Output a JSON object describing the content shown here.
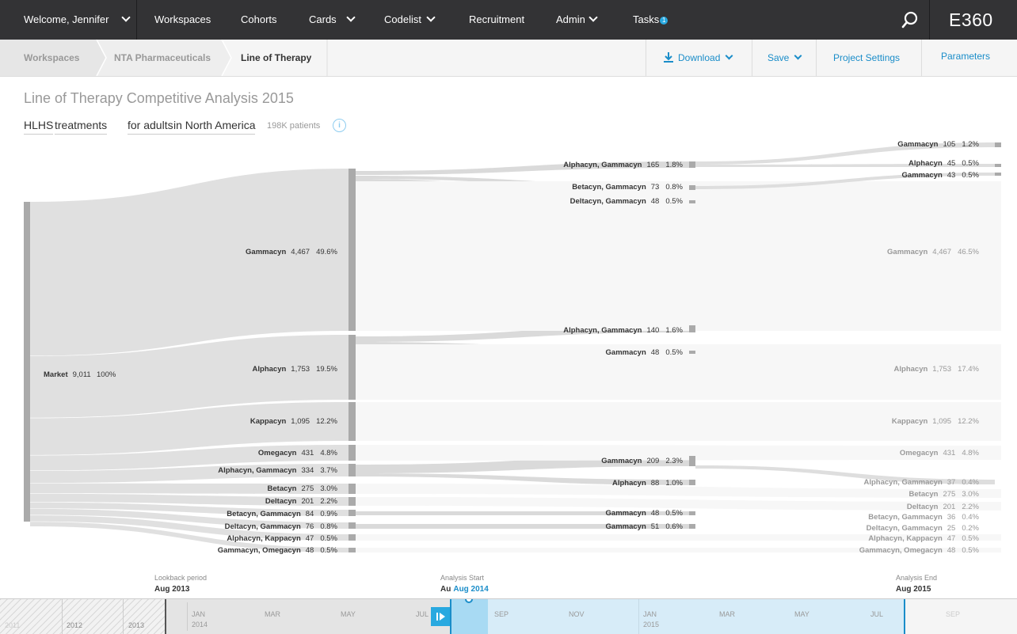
{
  "nav": {
    "welcome": "Welcome, Jennifer",
    "items": [
      "Workspaces",
      "Cohorts",
      "Cards",
      "Codelist",
      "Recruitment",
      "Admin",
      "Tasks"
    ],
    "tasks_badge": "1",
    "brand": "E360",
    "search_icon": "search-icon"
  },
  "breadcrumb": {
    "items": [
      "Workspaces",
      "NTA Pharmaceuticals",
      "Line of Therapy"
    ]
  },
  "actions": {
    "download": "Download",
    "save": "Save",
    "project_settings": "Project Settings",
    "parameters": "Parameters",
    "download_icon": "download-icon"
  },
  "page": {
    "title": "Line of Therapy Competitive Analysis 2015",
    "filters": [
      "HLHS",
      "treatments",
      "for adults",
      "in North America"
    ],
    "patients": "198K patients",
    "info_icon": "info-icon"
  },
  "colors": {
    "accent": "#1a8dc9",
    "topbar": "#333335",
    "node": "#aaaaaa",
    "link": "#dddddd"
  },
  "sankey": {
    "root": {
      "name": "Market",
      "count": "9,011",
      "pct": "100%"
    },
    "level1": [
      {
        "name": "Gammacyn",
        "count": "4,467",
        "pct": "49.6%"
      },
      {
        "name": "Alphacyn",
        "count": "1,753",
        "pct": "19.5%"
      },
      {
        "name": "Kappacyn",
        "count": "1,095",
        "pct": "12.2%"
      },
      {
        "name": "Omegacyn",
        "count": "431",
        "pct": "4.8%"
      },
      {
        "name": "Alphacyn, Gammacyn",
        "count": "334",
        "pct": "3.7%"
      },
      {
        "name": "Betacyn",
        "count": "275",
        "pct": "3.0%"
      },
      {
        "name": "Deltacyn",
        "count": "201",
        "pct": "2.2%"
      },
      {
        "name": "Betacyn, Gammacyn",
        "count": "84",
        "pct": "0.9%"
      },
      {
        "name": "Deltacyn, Gammacyn",
        "count": "76",
        "pct": "0.8%"
      },
      {
        "name": "Alphacyn, Kappacyn",
        "count": "47",
        "pct": "0.5%"
      },
      {
        "name": "Gammacyn, Omegacyn",
        "count": "48",
        "pct": "0.5%"
      }
    ],
    "level2": [
      {
        "name": "Alphacyn, Gammacyn",
        "count": "165",
        "pct": "1.8%"
      },
      {
        "name": "Betacyn, Gammacyn",
        "count": "73",
        "pct": "0.8%"
      },
      {
        "name": "Deltacyn, Gammacyn",
        "count": "48",
        "pct": "0.5%"
      },
      {
        "name": "Alphacyn, Gammacyn",
        "count": "140",
        "pct": "1.6%"
      },
      {
        "name": "Gammacyn",
        "count": "48",
        "pct": "0.5%"
      },
      {
        "name": "Gammacyn",
        "count": "209",
        "pct": "2.3%"
      },
      {
        "name": "Alphacyn",
        "count": "88",
        "pct": "1.0%"
      },
      {
        "name": "Gammacyn",
        "count": "48",
        "pct": "0.5%"
      },
      {
        "name": "Gammacyn",
        "count": "51",
        "pct": "0.6%"
      }
    ],
    "level3": [
      {
        "name": "Gammacyn",
        "count": "105",
        "pct": "1.2%"
      },
      {
        "name": "Alphacyn",
        "count": "45",
        "pct": "0.5%"
      },
      {
        "name": "Gammacyn",
        "count": "43",
        "pct": "0.5%"
      },
      {
        "name": "Gammacyn",
        "count": "4,467",
        "pct": "46.5%"
      },
      {
        "name": "Alphacyn",
        "count": "1,753",
        "pct": "17.4%"
      },
      {
        "name": "Kappacyn",
        "count": "1,095",
        "pct": "12.2%"
      },
      {
        "name": "Omegacyn",
        "count": "431",
        "pct": "4.8%"
      },
      {
        "name": "Alphacyn, Gammacyn",
        "count": "37",
        "pct": "0.4%"
      },
      {
        "name": "Betacyn",
        "count": "275",
        "pct": "3.0%"
      },
      {
        "name": "Deltacyn",
        "count": "201",
        "pct": "2.2%"
      },
      {
        "name": "Betacyn, Gammacyn",
        "count": "36",
        "pct": "0.4%"
      },
      {
        "name": "Deltacyn, Gammacyn",
        "count": "25",
        "pct": "0.2%"
      },
      {
        "name": "Alphacyn, Kappacyn",
        "count": "47",
        "pct": "0.5%"
      },
      {
        "name": "Gammacyn, Omegacyn",
        "count": "48",
        "pct": "0.5%"
      }
    ]
  },
  "timeline": {
    "lookback_label": "Lookback period",
    "lookback_value": "Aug 2013",
    "start_label": "Analysis Start",
    "start_prefix": "Au",
    "start_value": "Aug 2014",
    "end_label": "Analysis End",
    "end_value": "Aug 2015",
    "years": [
      "2011",
      "2012",
      "2013"
    ],
    "months": [
      "JAN",
      "MAR",
      "MAY",
      "JUL",
      "SEP",
      "NOV",
      "JAN",
      "MAR",
      "MAY",
      "JUL",
      "SEP"
    ],
    "month_years": [
      "2014",
      "2015"
    ],
    "play_icon": "play-icon"
  }
}
